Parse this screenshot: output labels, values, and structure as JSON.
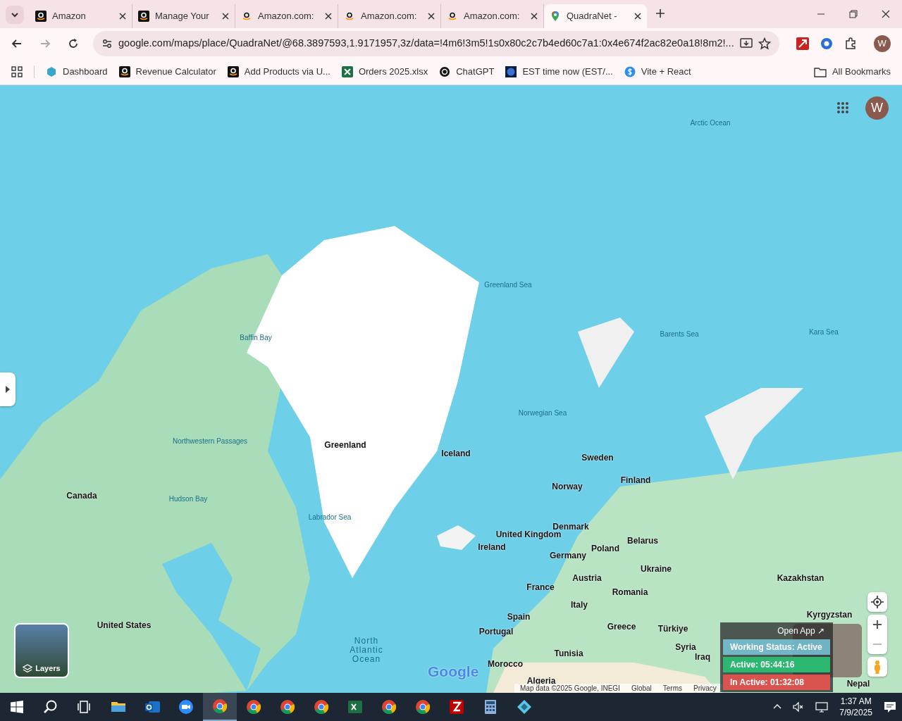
{
  "tabs": [
    {
      "title": "Amazon",
      "selected": false
    },
    {
      "title": "Manage Your",
      "selected": false
    },
    {
      "title": "Amazon.com:",
      "selected": false
    },
    {
      "title": "Amazon.com:",
      "selected": false
    },
    {
      "title": "Amazon.com:",
      "selected": false
    },
    {
      "title": "QuadraNet -",
      "selected": true
    }
  ],
  "address_bar": {
    "url": "google.com/maps/place/QuadraNet/@68.3897593,1.9171957,3z/data=!4m6!3m5!1s0x80c2c7b4ed60c7a1:0x4e674f2ac82e0a18!8m2!..."
  },
  "profile": {
    "initial": "W"
  },
  "bookmarks": [
    {
      "label": "Dashboard"
    },
    {
      "label": "Revenue Calculator"
    },
    {
      "label": "Add Products via U..."
    },
    {
      "label": "Orders 2025.xlsx"
    },
    {
      "label": "ChatGPT"
    },
    {
      "label": "EST time now (EST/..."
    },
    {
      "label": "Vite + React"
    }
  ],
  "all_bookmarks": "All Bookmarks",
  "map": {
    "account_initial": "W",
    "labels": [
      {
        "text": "Arctic Ocean",
        "kind": "sea"
      },
      {
        "text": "Greenland Sea",
        "kind": "sea"
      },
      {
        "text": "Baffin Bay",
        "kind": "sea"
      },
      {
        "text": "Barents Sea",
        "kind": "sea"
      },
      {
        "text": "Kara Sea",
        "kind": "sea"
      },
      {
        "text": "Greenland",
        "kind": "country"
      },
      {
        "text": "Iceland",
        "kind": "country"
      },
      {
        "text": "Norwegian Sea",
        "kind": "sea"
      },
      {
        "text": "Northwestern Passages",
        "kind": "sea"
      },
      {
        "text": "Sweden",
        "kind": "country"
      },
      {
        "text": "Finland",
        "kind": "country"
      },
      {
        "text": "Norway",
        "kind": "country"
      },
      {
        "text": "Canada",
        "kind": "country"
      },
      {
        "text": "Hudson Bay",
        "kind": "sea"
      },
      {
        "text": "Labrador Sea",
        "kind": "sea"
      },
      {
        "text": "Denmark",
        "kind": "country"
      },
      {
        "text": "United Kingdom",
        "kind": "country"
      },
      {
        "text": "Ireland",
        "kind": "country"
      },
      {
        "text": "Poland",
        "kind": "country"
      },
      {
        "text": "Belarus",
        "kind": "country"
      },
      {
        "text": "Germany",
        "kind": "country"
      },
      {
        "text": "Ukraine",
        "kind": "country"
      },
      {
        "text": "Kazakhstan",
        "kind": "country"
      },
      {
        "text": "France",
        "kind": "country"
      },
      {
        "text": "Austria",
        "kind": "country"
      },
      {
        "text": "Romania",
        "kind": "country"
      },
      {
        "text": "Italy",
        "kind": "country"
      },
      {
        "text": "Spain",
        "kind": "country"
      },
      {
        "text": "Portugal",
        "kind": "country"
      },
      {
        "text": "Greece",
        "kind": "country"
      },
      {
        "text": "Türkiye",
        "kind": "country"
      },
      {
        "text": "Tunisia",
        "kind": "country"
      },
      {
        "text": "Syria",
        "kind": "country"
      },
      {
        "text": "Iraq",
        "kind": "country"
      },
      {
        "text": "Morocco",
        "kind": "country"
      },
      {
        "text": "Algeria",
        "kind": "country"
      },
      {
        "text": "United States",
        "kind": "country"
      },
      {
        "text": "North Atlantic Ocean",
        "kind": "ocean"
      },
      {
        "text": "Kyrgyzstan",
        "kind": "country"
      },
      {
        "text": "Nepal",
        "kind": "country"
      }
    ],
    "layers_label": "Layers",
    "logo": "Google",
    "footer": [
      "Map data ©2025 Google, INEGI",
      "Global",
      "Terms",
      "Privacy"
    ]
  },
  "status_widget": {
    "open_app": "Open App ↗",
    "working_status": "Working Status: Active",
    "active": "Active: 05:44:16",
    "inactive": "In Active: 01:32:08"
  },
  "taskbar": {
    "apps": [
      {
        "kind": "explorer",
        "active": false
      },
      {
        "kind": "outlook",
        "active": false
      },
      {
        "kind": "zoom",
        "active": false
      },
      {
        "kind": "chrome",
        "active": true
      },
      {
        "kind": "chrome",
        "active": false
      },
      {
        "kind": "chrome",
        "active": false
      },
      {
        "kind": "chrome",
        "active": false
      },
      {
        "kind": "excel",
        "active": false
      },
      {
        "kind": "chrome",
        "active": false
      },
      {
        "kind": "chrome",
        "active": false
      },
      {
        "kind": "filezilla",
        "active": false
      },
      {
        "kind": "calculator",
        "active": false
      },
      {
        "kind": "app",
        "active": false
      }
    ],
    "time": "1:37 AM",
    "date": "7/9/2025"
  }
}
